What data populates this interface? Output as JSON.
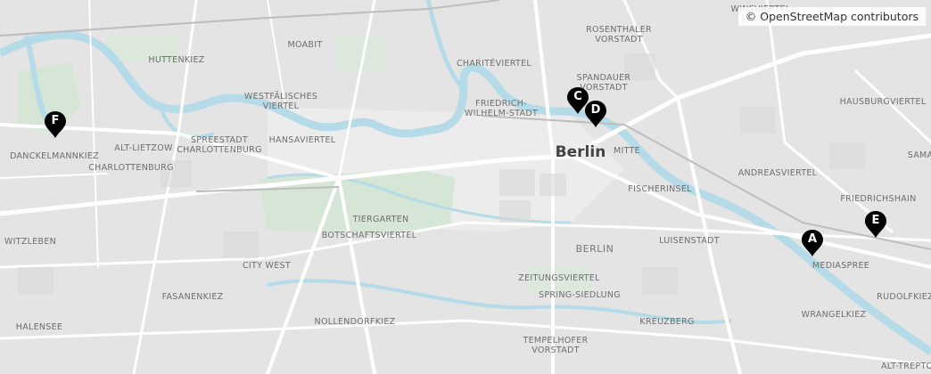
{
  "attribution": "© OpenStreetMap contributors",
  "city": "Berlin",
  "district": "BERLIN",
  "labels": {
    "winsviertel": "WINSVIERTEL",
    "moabit": "MOABIT",
    "huttenkiez": "HUTTENKIEZ",
    "rosenthaler": "ROSENTHALER\nVORSTADT",
    "charite": "CHARITÉVIERTEL",
    "spandauer": "SPANDAUER\nVORSTADT",
    "westfaelisches": "WESTFÄLISCHES\nVIERTEL",
    "hausburg": "HAUSBURGVIERTEL",
    "friedrich_wilhelm": "FRIEDRICH-\nWILHELM-STADT",
    "alt_lietzow": "ALT-LIETZOW",
    "spreestadt": "SPREESTADT\nCHARLOTTENBURG",
    "hansaviertel": "HANSAVIERTEL",
    "mitte": "MITTE",
    "danckelmann": "DANCKELMANNKIEZ",
    "charlottenburg": "CHARLOTTENBURG",
    "andreas": "ANDREASVIERTEL",
    "sama": "SAMA",
    "fischerinsel": "FISCHERINSEL",
    "friedrichshain": "FRIEDRICHSHAIN",
    "tiergarten": "TIERGARTEN",
    "botschafts": "BOTSCHAFTSVIERTEL",
    "witzleben": "WITZLEBEN",
    "luisenstadt": "LUISENSTADT",
    "mediaspree": "MEDIASPREE",
    "city_west": "CITY WEST",
    "zeitungs": "ZEITUNGSVIERTEL",
    "spring": "SPRING-SIEDLUNG",
    "rudolfkiez": "RUDOLFKIEZ",
    "fasanen": "FASANENKIEZ",
    "nollendorf": "NOLLENDORFKIEZ",
    "wrangel": "WRANGELKIEZ",
    "kreuzberg": "KREUZBERG",
    "halensee": "HALENSEE",
    "tempelhofer": "TEMPELHOFER\nVORSTADT",
    "alt_treptow": "ALT-TREPTOW"
  },
  "markers": [
    {
      "letter": "A"
    },
    {
      "letter": "C"
    },
    {
      "letter": "D"
    },
    {
      "letter": "E"
    },
    {
      "letter": "F"
    }
  ],
  "colors": {
    "land": "#e6e6e6",
    "water": "#b5dbe8",
    "park": "#d4e6d4",
    "road": "#ffffff",
    "marker": "#000000"
  }
}
